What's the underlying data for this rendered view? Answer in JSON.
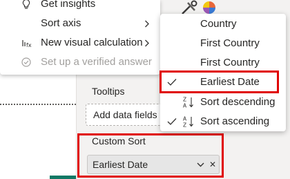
{
  "context_menu": {
    "items": [
      {
        "label": "Get insights",
        "icon": "lightbulb-icon"
      },
      {
        "label": "Sort axis",
        "icon": "",
        "has_submenu": true
      },
      {
        "label": "New visual calculation",
        "icon": "visual-calculation-icon",
        "has_submenu": true
      },
      {
        "label": "Set up a verified answer",
        "icon": "verified-check-icon",
        "disabled": true
      }
    ]
  },
  "sort_submenu": {
    "items": [
      {
        "label": "Country",
        "checked": false
      },
      {
        "label": "First Country",
        "checked": false
      },
      {
        "label": "First Country",
        "checked": false
      },
      {
        "label": "Earliest Date",
        "checked": true
      },
      {
        "label": "Sort descending",
        "icon": "sort-descending-za-icon",
        "checked": false
      },
      {
        "label": "Sort ascending",
        "icon": "sort-ascending-az-icon",
        "checked": true
      }
    ]
  },
  "build_pane": {
    "tooltips_title": "Tooltips",
    "tooltips_placeholder": "Add data fields",
    "custom_sort_title": "Custom Sort",
    "custom_sort_field": "Earliest Date"
  },
  "colors": {
    "highlight": "#e00000",
    "pane_bg": "#f3f2f1",
    "accent_green": "#117865"
  }
}
